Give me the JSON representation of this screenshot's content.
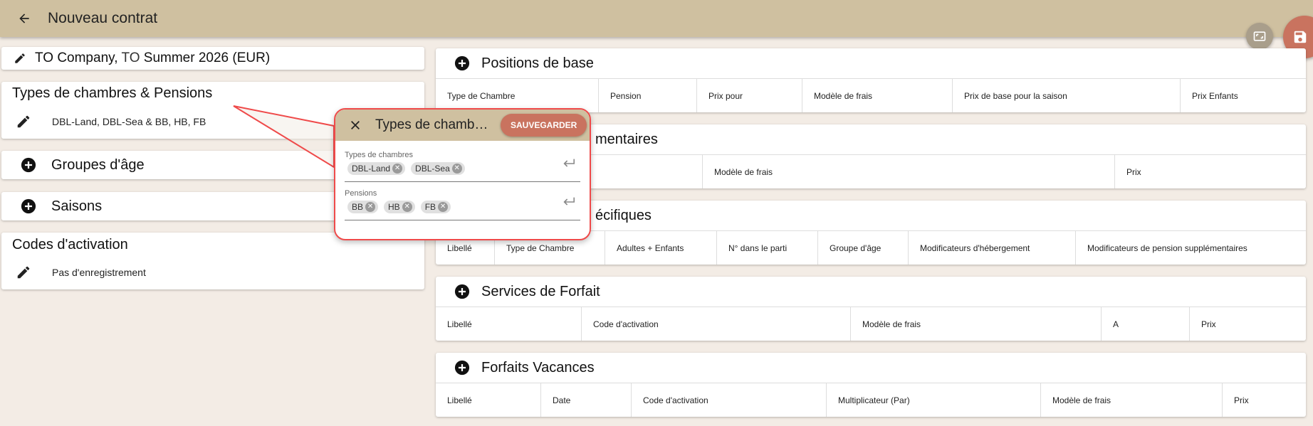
{
  "header": {
    "title": "Nouveau contrat"
  },
  "summary": {
    "prefix": "TO Company, ",
    "mid": "TO",
    "suffix": " Summer 2026 (EUR)"
  },
  "room_types": {
    "title": "Types de chambres & Pensions",
    "value": "DBL-Land, DBL-Sea & BB, HB, FB"
  },
  "age_groups": {
    "title": "Groupes d'âge"
  },
  "seasons": {
    "title": "Saisons"
  },
  "activation_codes": {
    "title": "Codes d'activation",
    "value": "Pas d'enregistrement"
  },
  "popover": {
    "title": "Types de chambres & Pensions",
    "save_label": "SAUVEGARDER",
    "room_field": {
      "label": "Types de chambres",
      "chips": [
        "DBL-Land",
        "DBL-Sea"
      ]
    },
    "board_field": {
      "label": "Pensions",
      "chips": [
        "BB",
        "HB",
        "FB"
      ]
    }
  },
  "sections": [
    {
      "title": "Positions de base",
      "columns": [
        "Type de Chambre",
        "Pension",
        "Prix pour",
        "Modèle de frais",
        "Prix de base pour la saison",
        "Prix Enfants"
      ]
    },
    {
      "title": "mentaires",
      "columns": [
        "",
        "Modèle de frais",
        "Prix"
      ]
    },
    {
      "title": "écifiques",
      "columns": [
        "Libellé",
        "Type de Chambre",
        "Adultes + Enfants",
        "N° dans le parti",
        "Groupe d'âge",
        "Modificateurs d'hébergement",
        "Modificateurs de pension supplémentaires"
      ]
    },
    {
      "title": "Services de Forfait",
      "columns": [
        "Libellé",
        "Code d'activation",
        "Modèle de frais",
        "A",
        "Prix"
      ]
    },
    {
      "title": "Forfaits Vacances",
      "columns": [
        "Libellé",
        "Date",
        "Code d'activation",
        "Multiplicateur (Par)",
        "Modèle de frais",
        "Prix"
      ]
    }
  ],
  "colors": {
    "header": "#cfc0a0",
    "background": "#f3ece5",
    "accent": "#c9735f",
    "callout": "#ef4a4a"
  }
}
